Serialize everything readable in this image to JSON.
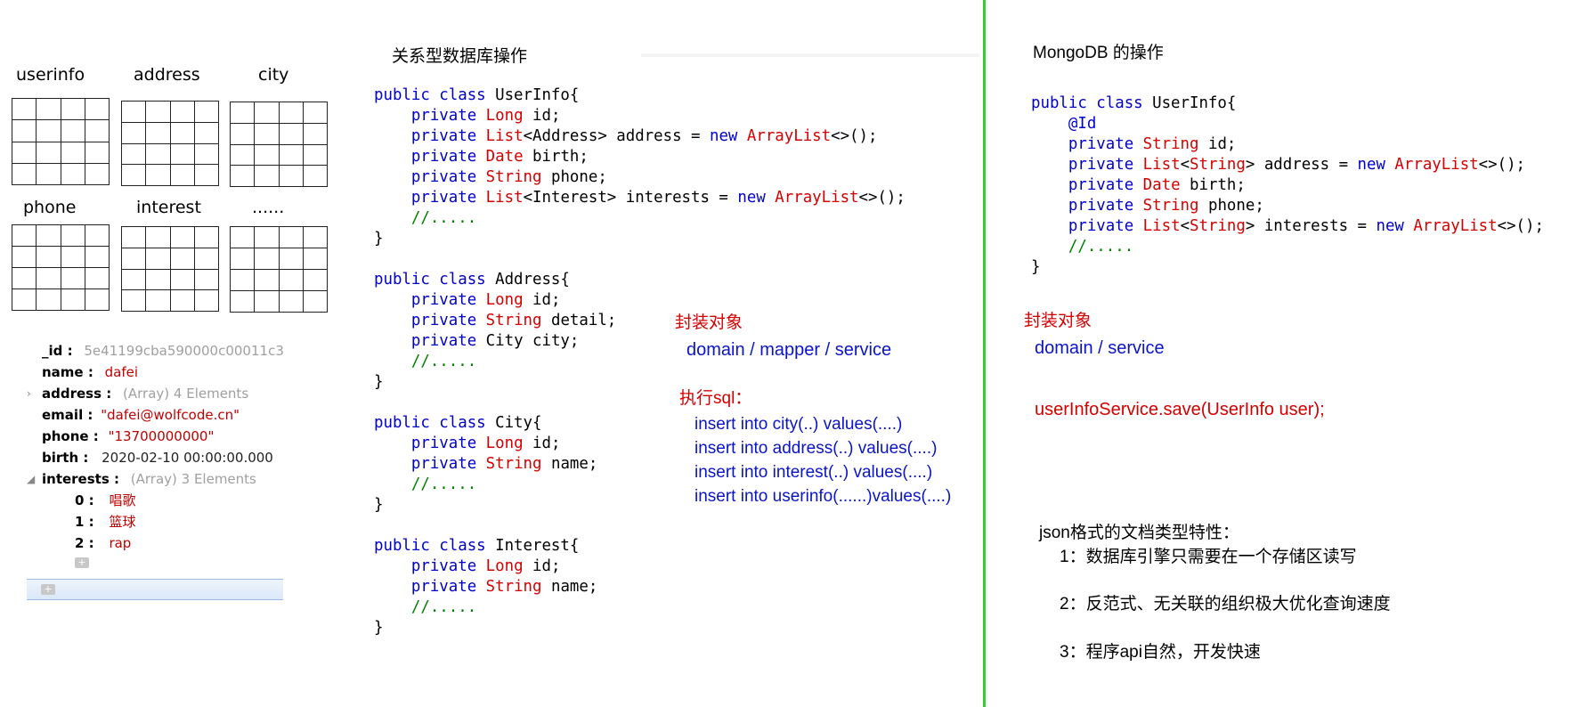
{
  "tables": {
    "labels": [
      "userinfo",
      "address",
      "city",
      "phone",
      "interest",
      "......"
    ]
  },
  "document": {
    "id_key": "_id :",
    "id_val": "5e41199cba590000c00011c3",
    "name_key": "name :",
    "name_val": "dafei",
    "address_key": "address :",
    "address_val": "(Array) 4 Elements",
    "email_key": "email :",
    "email_val": "\"dafei@wolfcode.cn\"",
    "phone_key": "phone :",
    "phone_val": "\"13700000000\"",
    "birth_key": "birth :",
    "birth_val": "2020-02-10 00:00:00.000",
    "interests_key": "interests :",
    "interests_val": "(Array) 3 Elements",
    "interests": [
      {
        "idx": "0 :",
        "val": "唱歌"
      },
      {
        "idx": "1 :",
        "val": "篮球"
      },
      {
        "idx": "2 :",
        "val": "rap"
      }
    ],
    "add_symbol": "+"
  },
  "relational": {
    "title": "关系型数据库操作",
    "encapsulate_label": "封装对象",
    "layers": "domain / mapper / service",
    "sql_label": "执行sql：",
    "sql_lines": [
      "insert into city(..) values(....)",
      "insert into address(..) values(....)",
      "insert into interest(..) values(....)",
      "insert into userinfo(......)values(....)"
    ]
  },
  "mongo": {
    "title": "MongoDB 的操作",
    "encapsulate_label": "封装对象",
    "layers": "domain /  service",
    "save_call": "userInfoService.save(UserInfo user);",
    "features_title": "json格式的文档类型特性：",
    "features": [
      "1：数据库引擎只需要在一个存储区读写",
      "2：反范式、无关联的组织极大优化查询速度",
      "3：程序api自然，开发快速"
    ]
  },
  "colors": {
    "keyword": "#0000cc",
    "type": "#d50000",
    "comment": "#008000",
    "divider": "#33cc33",
    "red_label": "#d40000",
    "blue_label": "#0a14c8"
  }
}
